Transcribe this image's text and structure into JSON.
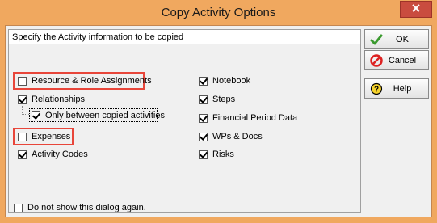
{
  "window": {
    "title": "Copy Activity Options",
    "close_glyph": "✕"
  },
  "panel": {
    "header": "Specify the Activity information to be copied"
  },
  "options_left": [
    {
      "label": "Resource & Role Assignments",
      "checked": false
    },
    {
      "label": "Relationships",
      "checked": true
    },
    {
      "label": "Only between copied activities",
      "checked": true
    },
    {
      "label": "Expenses",
      "checked": false
    },
    {
      "label": "Activity Codes",
      "checked": true
    }
  ],
  "options_right": [
    {
      "label": "Notebook",
      "checked": true
    },
    {
      "label": "Steps",
      "checked": true
    },
    {
      "label": "Financial Period Data",
      "checked": true
    },
    {
      "label": "WPs & Docs",
      "checked": true
    },
    {
      "label": "Risks",
      "checked": true
    }
  ],
  "buttons": {
    "ok": "OK",
    "cancel": "Cancel",
    "help": "Help"
  },
  "footer": {
    "label": "Do not show this dialog again.",
    "checked": false
  },
  "colors": {
    "frame": "#f0a85f",
    "close": "#c94c3f",
    "highlight": "#e8463a"
  },
  "icons": {
    "ok": "checkmark-icon",
    "cancel": "no-entry-icon",
    "help": "help-question-icon",
    "close": "close-icon"
  }
}
